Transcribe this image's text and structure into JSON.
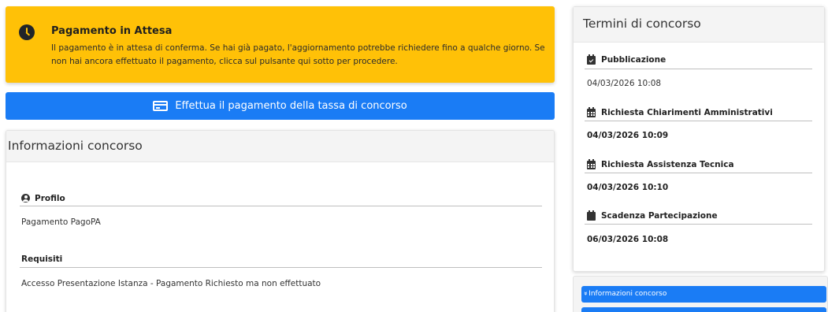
{
  "alert": {
    "title": "Pagamento in Attesa",
    "text": "Il pagamento è in attesa di conferma. Se hai già pagato, l'aggiornamento potrebbe richiedere fino a qualche giorno. Se non hai ancora effettuato il pagamento, clicca sul pulsante qui sotto per procedere.",
    "icon": "clock-icon",
    "color": "#ffc107"
  },
  "pay_button": {
    "label": "Effettua il pagamento della tassa di concorso",
    "icon": "credit-card-icon",
    "color": "#1a7cf5"
  },
  "info": {
    "title": "Informazioni concorso",
    "fields": [
      {
        "label": "Profilo",
        "value": "Pagamento PagoPA",
        "icon": "user-circle-icon"
      },
      {
        "label": "Requisiti",
        "value": "Accesso Presentazione Istanza - Pagamento Richiesto ma non effettuato"
      }
    ]
  },
  "terms": {
    "title": "Termini di concorso",
    "items": [
      {
        "label": "Pubblicazione",
        "value": "04/03/2026 10:08",
        "icon": "calendar-check-icon"
      },
      {
        "label": "Richiesta Chiarimenti Amministrativi",
        "value": "04/03/2026 10:09",
        "icon": "calendar-icon"
      },
      {
        "label": "Richiesta Assistenza Tecnica",
        "value": "04/03/2026 10:10",
        "icon": "calendar-icon"
      },
      {
        "label": "Scadenza Partecipazione",
        "value": "06/03/2026 10:08",
        "icon": "calendar-solid-icon"
      }
    ]
  },
  "nav": {
    "items": [
      {
        "label": "Informazioni concorso",
        "icon": "double-chevron-down-icon"
      }
    ]
  }
}
